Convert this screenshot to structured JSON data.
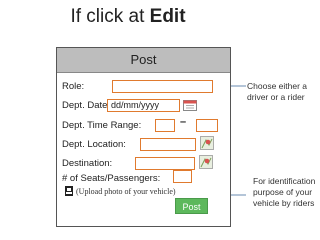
{
  "heading": {
    "prefix": "If click at ",
    "bold": "Edit"
  },
  "form": {
    "title": "Post",
    "role_label": "Role:",
    "dept_date_label": "Dept. Date:",
    "dept_date_placeholder": "dd/mm/yyyy",
    "dept_time_label": "Dept. Time Range:",
    "time_separator": "–",
    "dept_location_label": "Dept. Location:",
    "destination_label": "Destination:",
    "seats_label": "# of Seats/Passengers:",
    "upload_label": "(Upload photo of your vehicle)",
    "post_button": "Post"
  },
  "notes": {
    "role_note_line1": "Choose either a",
    "role_note_line2": "driver or a rider",
    "photo_note_line1": "For identification",
    "photo_note_line2": "purpose of your",
    "photo_note_line3": "vehicle by riders"
  },
  "colors": {
    "field_border": "#e07a2e",
    "header_bg": "#bdbdbd",
    "post_button": "#5db85c"
  },
  "icons": [
    "calendar-icon",
    "map-pin-icon",
    "map-pin-icon",
    "car-photo-icon"
  ]
}
